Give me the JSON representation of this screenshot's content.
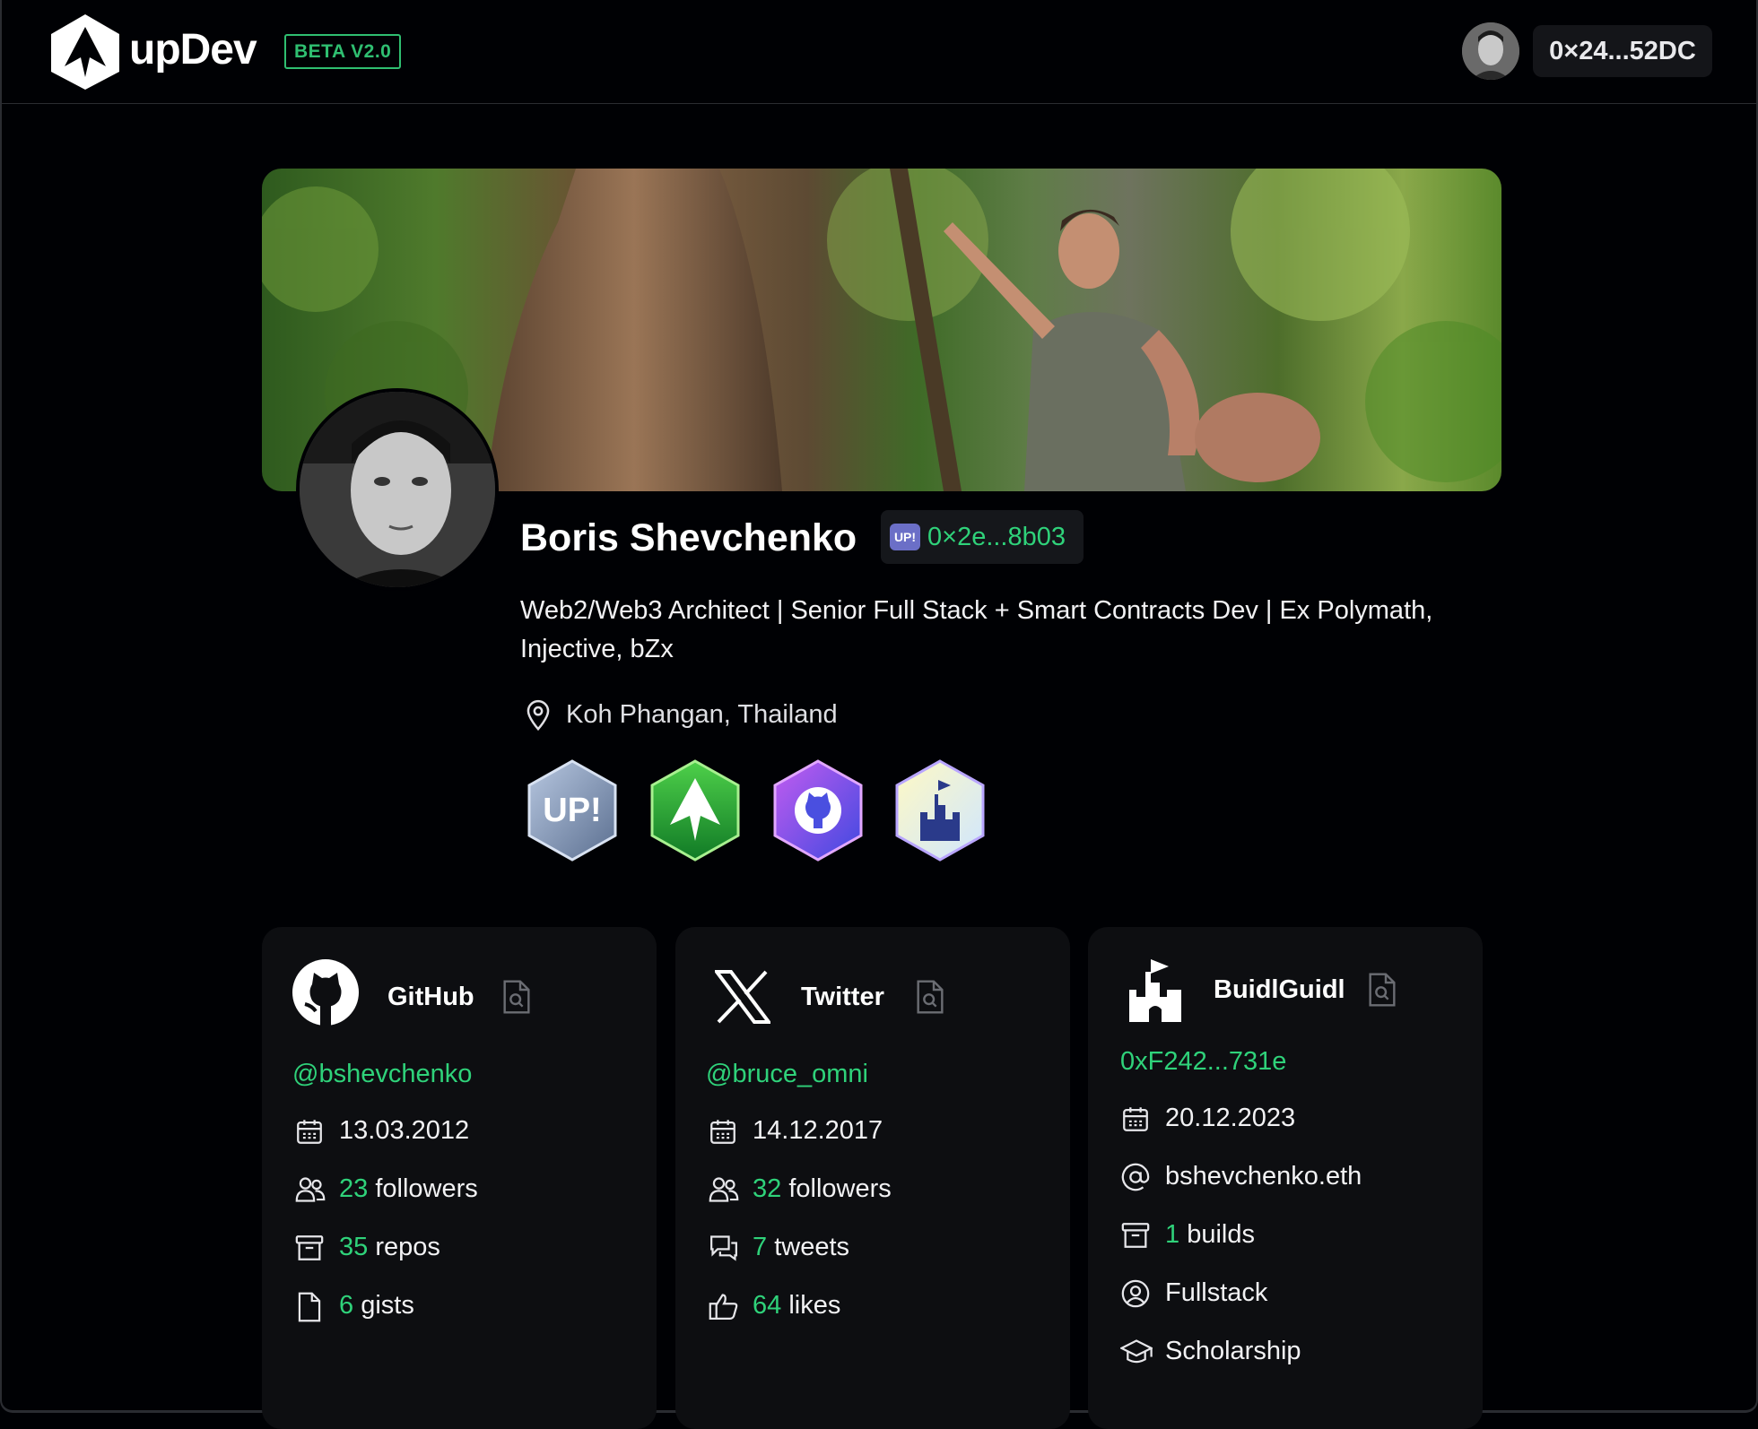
{
  "header": {
    "brand": "upDev",
    "beta_label": "BETA V2.0",
    "wallet_address": "0×24...52DC"
  },
  "profile": {
    "name": "Boris Shevchenko",
    "address": "0×2e...8b03",
    "up_tag": "UP!",
    "bio": "Web2/Web3 Architect | Senior Full Stack + Smart Contracts Dev | Ex Polymath, Injective, bZx",
    "location": "Koh Phangan, Thailand",
    "badges": [
      {
        "icon": "up-badge",
        "label": "UP!"
      },
      {
        "icon": "updev-badge"
      },
      {
        "icon": "github-badge"
      },
      {
        "icon": "buidlguidl-badge"
      }
    ]
  },
  "colors": {
    "accent_green": "#2fd27a",
    "background": "#000104",
    "card_bg": "#0d0e11"
  },
  "cards": {
    "github": {
      "title": "GitHub",
      "handle": "@bshevchenko",
      "joined": "13.03.2012",
      "followers_count": "23",
      "followers_label": "followers",
      "repos_count": "35",
      "repos_label": "repos",
      "gists_count": "6",
      "gists_label": "gists"
    },
    "twitter": {
      "title": "Twitter",
      "handle": "@bruce_omni",
      "joined": "14.12.2017",
      "followers_count": "32",
      "followers_label": "followers",
      "tweets_count": "7",
      "tweets_label": "tweets",
      "likes_count": "64",
      "likes_label": "likes"
    },
    "buidlguidl": {
      "title": "BuidlGuidl",
      "address": "0xF242...731e",
      "joined": "20.12.2023",
      "ens": "bshevchenko.eth",
      "builds_count": "1",
      "builds_label": "builds",
      "role": "Fullstack",
      "status": "Scholarship"
    }
  }
}
